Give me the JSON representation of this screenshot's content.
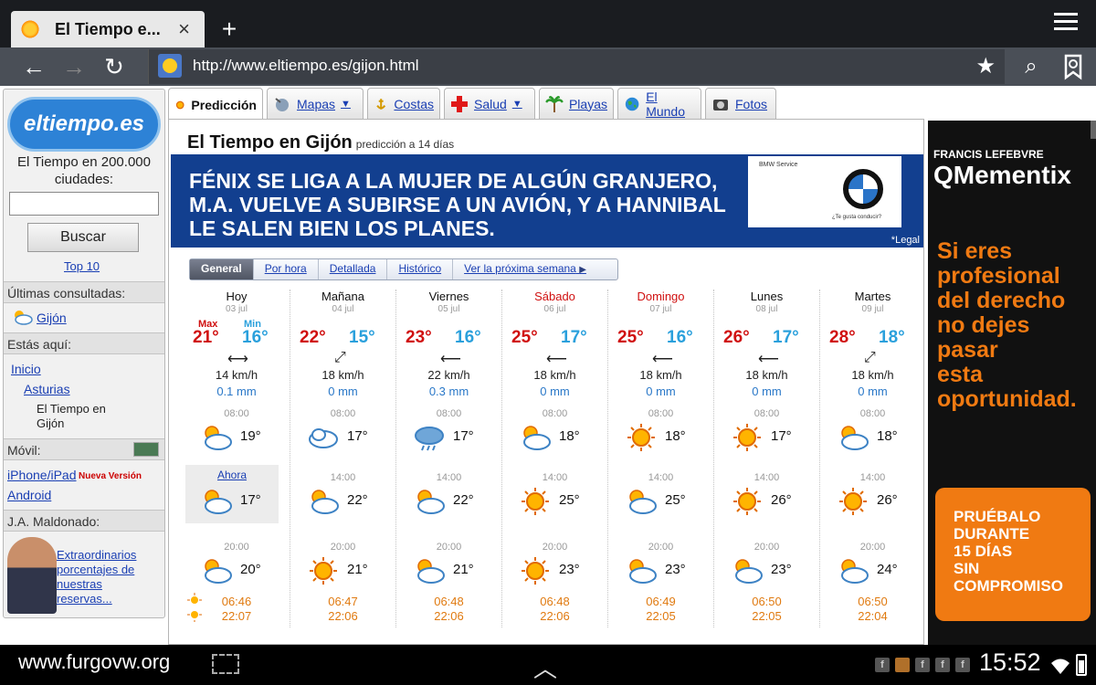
{
  "browser": {
    "tab_title": "El Tiempo e...",
    "close_glyph": "×",
    "new_tab_glyph": "+",
    "back_glyph": "←",
    "forward_glyph": "→",
    "reload_glyph": "↻",
    "url": "http://www.eltiempo.es/gijon.html",
    "star_glyph": "★",
    "search_glyph": "⌕"
  },
  "sidebar": {
    "logo": "eltiempo.es",
    "intro": "El Tiempo en 200.000 ciudades:",
    "search_value": "",
    "search_button": "Buscar",
    "top_link": "Top 10",
    "recent_header": "Últimas consultadas:",
    "recent_item": "Gijón",
    "here_header": "Estás aquí:",
    "crumb_home": "Inicio",
    "crumb_region": "Asturias",
    "crumb_current_1": "El Tiempo en",
    "crumb_current_2": "Gijón",
    "mobile_header": "Móvil:",
    "mobile_iphone": "iPhone/iPad",
    "mobile_new": "Nueva Versión",
    "mobile_android": "Android",
    "promo_header": "J.A. Maldonado:",
    "promo_link_1": "Extraordinarios",
    "promo_link_2": "porcentajes de",
    "promo_link_3": "nuestras",
    "promo_link_4": "reservas..."
  },
  "sections": {
    "prediccion": "Predicción",
    "mapas": "Mapas",
    "costas": "Costas",
    "salud": "Salud",
    "playas": "Playas",
    "mundo": "El Mundo",
    "fotos": "Fotos",
    "caret": "▼"
  },
  "main": {
    "title": "El Tiempo en Gijón",
    "subtitle": "predicción a 14 días"
  },
  "banner": {
    "line1": "FÉNIX SE LIGA A LA MUJER DE ALGÚN GRANJERO,",
    "line2": "M.A. VUELVE A SUBIRSE A UN AVIÓN, Y A HANNIBAL",
    "line3": "LE SALEN BIEN LOS PLANES.",
    "service": "BMW Service",
    "tagline": "¿Te gusta conducir?",
    "legal": "*Legal"
  },
  "forecast_tabs": {
    "general": "General",
    "por_hora": "Por hora",
    "detallada": "Detallada",
    "historico": "Histórico",
    "next_week": "Ver la próxima semana",
    "next_arrow": "▶"
  },
  "labels": {
    "max": "Max",
    "min": "Min",
    "now": "Ahora"
  },
  "days": [
    {
      "name": "Hoy",
      "date": "03 jul",
      "max": "21°",
      "min": "16°",
      "wind_arrow": "⟷",
      "wind": "14 km/h",
      "rain": "0.1 mm",
      "t1": "08:00",
      "v1": "19°",
      "t2": "",
      "v2": "17°",
      "t3": "20:00",
      "v3": "20°",
      "sunrise": "06:46",
      "sunset": "22:07"
    },
    {
      "name": "Mañana",
      "date": "04 jul",
      "max": "22°",
      "min": "15°",
      "wind_arrow": "⤢",
      "wind": "18 km/h",
      "rain": "0 mm",
      "t1": "08:00",
      "v1": "17°",
      "t2": "14:00",
      "v2": "22°",
      "t3": "20:00",
      "v3": "21°",
      "sunrise": "06:47",
      "sunset": "22:06"
    },
    {
      "name": "Viernes",
      "date": "05 jul",
      "max": "23°",
      "min": "16°",
      "wind_arrow": "⟵",
      "wind": "22 km/h",
      "rain": "0.3 mm",
      "t1": "08:00",
      "v1": "17°",
      "t2": "14:00",
      "v2": "22°",
      "t3": "20:00",
      "v3": "21°",
      "sunrise": "06:48",
      "sunset": "22:06"
    },
    {
      "name": "Sábado",
      "date": "06 jul",
      "max": "25°",
      "min": "17°",
      "wind_arrow": "⟵",
      "wind": "18 km/h",
      "rain": "0 mm",
      "t1": "08:00",
      "v1": "18°",
      "t2": "14:00",
      "v2": "25°",
      "t3": "20:00",
      "v3": "23°",
      "sunrise": "06:48",
      "sunset": "22:06"
    },
    {
      "name": "Domingo",
      "date": "07 jul",
      "max": "25°",
      "min": "16°",
      "wind_arrow": "⟵",
      "wind": "18 km/h",
      "rain": "0 mm",
      "t1": "08:00",
      "v1": "18°",
      "t2": "14:00",
      "v2": "25°",
      "t3": "20:00",
      "v3": "23°",
      "sunrise": "06:49",
      "sunset": "22:05"
    },
    {
      "name": "Lunes",
      "date": "08 jul",
      "max": "26°",
      "min": "17°",
      "wind_arrow": "⟵",
      "wind": "18 km/h",
      "rain": "0 mm",
      "t1": "08:00",
      "v1": "17°",
      "t2": "14:00",
      "v2": "26°",
      "t3": "20:00",
      "v3": "23°",
      "sunrise": "06:50",
      "sunset": "22:05"
    },
    {
      "name": "Martes",
      "date": "09 jul",
      "max": "28°",
      "min": "18°",
      "wind_arrow": "⤢",
      "wind": "18 km/h",
      "rain": "0 mm",
      "t1": "08:00",
      "v1": "18°",
      "t2": "14:00",
      "v2": "26°",
      "t3": "20:00",
      "v3": "24°",
      "sunrise": "06:50",
      "sunset": "22:04"
    }
  ],
  "right_ad": {
    "brand1": "FRANCIS LEFEBVRE",
    "brand2": "QMementix",
    "slogan_1": "Si eres",
    "slogan_2": "profesional",
    "slogan_3": "del derecho",
    "slogan_4": "no dejes",
    "slogan_5": "pasar",
    "slogan_6": "esta",
    "slogan_7": "oportunidad.",
    "cta_1": "PRUÉBALO",
    "cta_2": "DURANTE",
    "cta_3": "15 DÍAS",
    "cta_4": "SIN",
    "cta_5": "COMPROMISO"
  },
  "system": {
    "watermark": "www.furgovw.org",
    "home_glyph": "︿",
    "clock": "15:52"
  },
  "colors": {
    "max_red": "#d01010",
    "min_blue": "#2aa0dc",
    "link_blue": "#1a3fb3",
    "ad_orange": "#f07a12",
    "banner_blue": "#123f8f"
  }
}
